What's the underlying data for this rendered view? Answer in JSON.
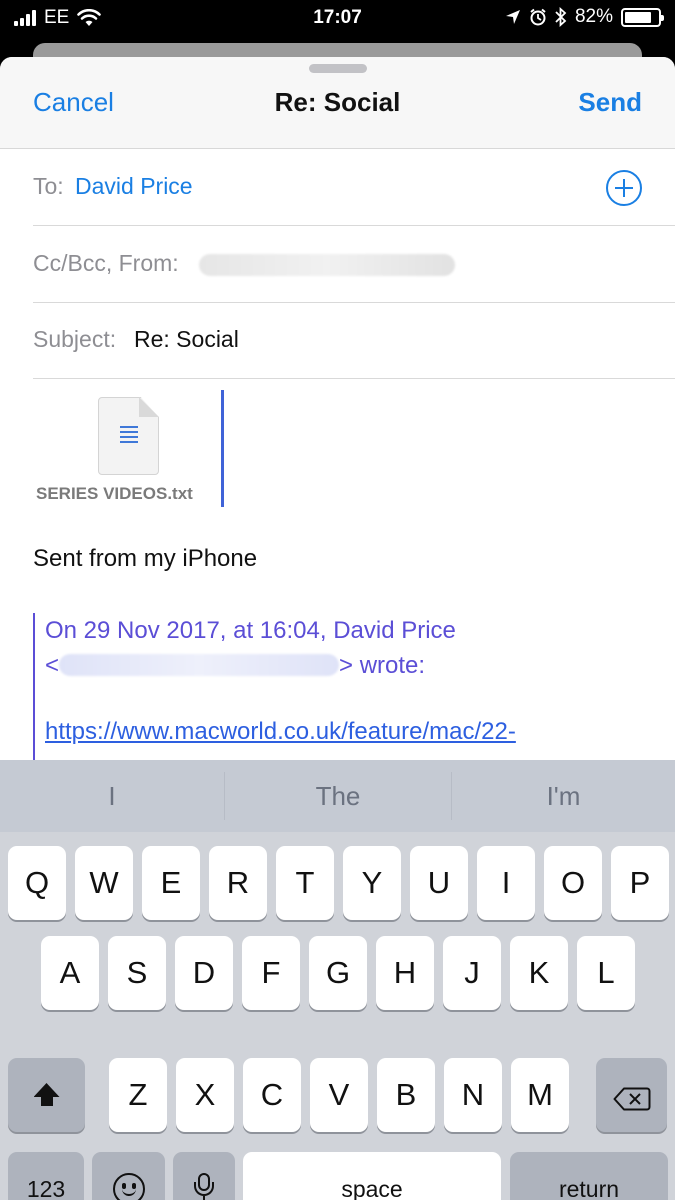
{
  "status_bar": {
    "carrier": "EE",
    "time": "17:07",
    "battery": "82%",
    "battery_level": 0.82
  },
  "compose": {
    "cancel_label": "Cancel",
    "title": "Re: Social",
    "send_label": "Send",
    "to_label": "To:",
    "to_value": "David Price",
    "cc_label": "Cc/Bcc, From:",
    "subject_label": "Subject:",
    "subject_value": "Re: Social",
    "attachment_name": "SERIES VIDEOS.txt",
    "signature": "Sent from my iPhone",
    "quote_header": "On 29 Nov 2017, at 16:04, David Price",
    "quote_open": "<",
    "quote_wrote": "> wrote:",
    "quote_link": "https://www.macworld.co.uk/feature/mac/22-"
  },
  "keyboard": {
    "predictions": [
      "I",
      "The",
      "I'm"
    ],
    "row1": [
      "Q",
      "W",
      "E",
      "R",
      "T",
      "Y",
      "U",
      "I",
      "O",
      "P"
    ],
    "row2": [
      "A",
      "S",
      "D",
      "F",
      "G",
      "H",
      "J",
      "K",
      "L"
    ],
    "row3": [
      "Z",
      "X",
      "C",
      "V",
      "B",
      "N",
      "M"
    ],
    "numbers_label": "123",
    "space_label": "space",
    "return_label": "return"
  },
  "colors": {
    "accent": "#1a7fe3",
    "quote": "#5b4ed6"
  }
}
